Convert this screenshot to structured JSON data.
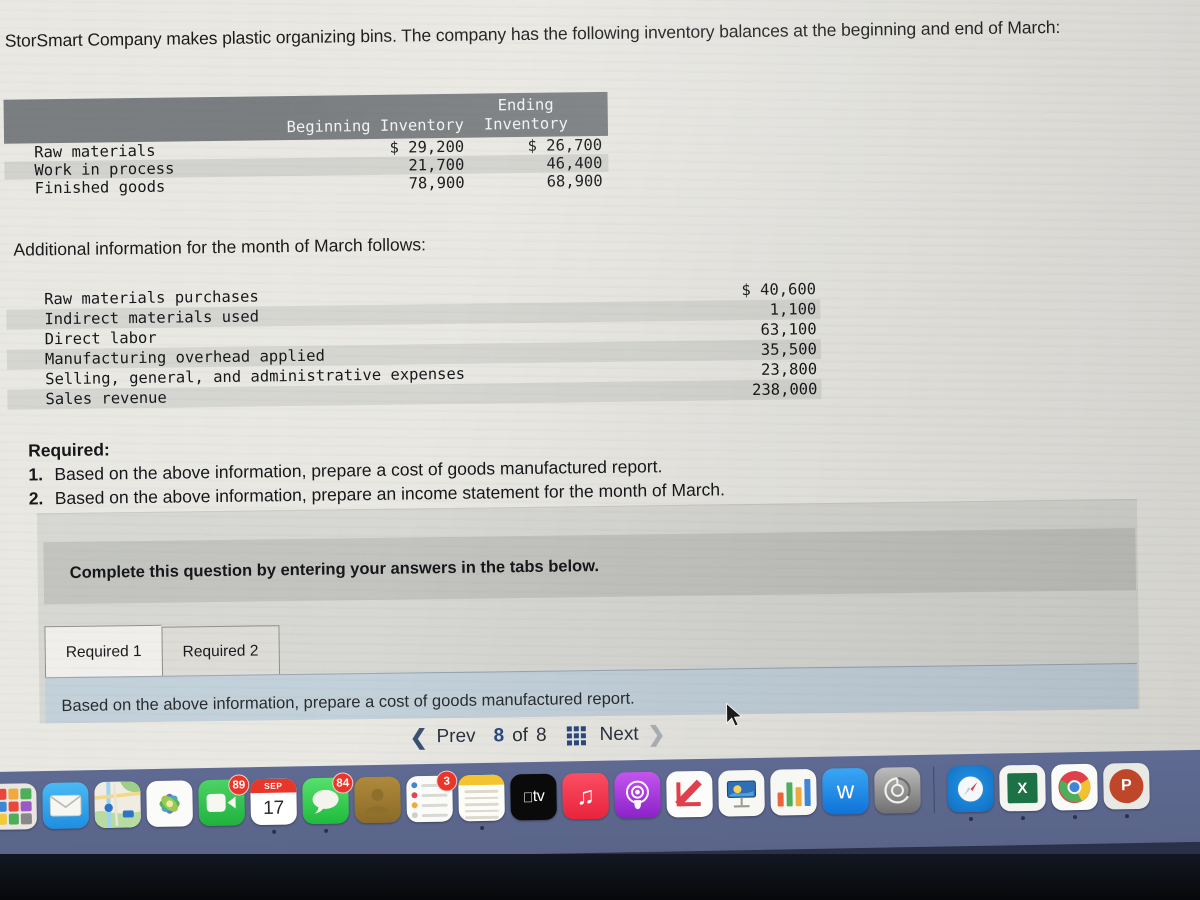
{
  "document": {
    "intro": "StorSmart Company makes plastic organizing bins. The company has the following inventory balances at the beginning and end of March:",
    "additional_title": "Additional information for the month of March follows:",
    "required_heading": "Required:",
    "required_items": [
      {
        "num": "1.",
        "text": "Based on the above information, prepare a cost of goods manufactured report."
      },
      {
        "num": "2.",
        "text": "Based on the above information, prepare an income statement for the month of March."
      }
    ]
  },
  "inventory_table": {
    "columns": [
      "",
      "Beginning Inventory",
      "Ending Inventory"
    ],
    "header_ending_line1": "Ending",
    "header_ending_line2": "Inventory",
    "header_beginning": "Beginning Inventory",
    "rows": [
      {
        "label": "Raw materials",
        "beginning": "$ 29,200",
        "ending": "$ 26,700"
      },
      {
        "label": "Work in process",
        "beginning": "21,700",
        "ending": "46,400"
      },
      {
        "label": "Finished goods",
        "beginning": "78,900",
        "ending": "68,900"
      }
    ]
  },
  "additional_info": {
    "rows": [
      {
        "label": "Raw materials purchases",
        "value": "$ 40,600"
      },
      {
        "label": "Indirect materials used",
        "value": "1,100"
      },
      {
        "label": "Direct labor",
        "value": "63,100"
      },
      {
        "label": "Manufacturing overhead applied",
        "value": "35,500"
      },
      {
        "label": "Selling, general, and administrative expenses",
        "value": "23,800"
      },
      {
        "label": "Sales revenue",
        "value": "238,000"
      }
    ]
  },
  "answer_panel": {
    "banner": "Complete this question by entering your answers in the tabs below.",
    "tabs": [
      {
        "label": "Required 1",
        "active": true
      },
      {
        "label": "Required 2",
        "active": false
      }
    ],
    "tab_body_text": "Based on the above information, prepare a cost of goods manufactured report."
  },
  "pager": {
    "prev_label": "Prev",
    "next_label": "Next",
    "current_page": "8",
    "of_label": "of",
    "total_pages": "8",
    "grid_icon": "grid-icon"
  },
  "dock": {
    "items": [
      {
        "name": "launchpad",
        "label": "Launchpad"
      },
      {
        "name": "mail",
        "label": "Mail"
      },
      {
        "name": "maps",
        "label": "Maps"
      },
      {
        "name": "photos",
        "label": "Photos"
      },
      {
        "name": "facetime",
        "label": "FaceTime",
        "badge": "89"
      },
      {
        "name": "calendar",
        "label": "Calendar",
        "month": "SEP",
        "day": "17",
        "running": true
      },
      {
        "name": "messages",
        "label": "Messages",
        "badge": "84",
        "running": true
      },
      {
        "name": "contacts",
        "label": "Contacts"
      },
      {
        "name": "reminders",
        "label": "Reminders",
        "badge": "3"
      },
      {
        "name": "notes",
        "label": "Notes",
        "running": true
      },
      {
        "name": "apple-tv",
        "label": "tv"
      },
      {
        "name": "music",
        "label": "Music"
      },
      {
        "name": "podcasts",
        "label": "Podcasts"
      },
      {
        "name": "news",
        "label": "News"
      },
      {
        "name": "keynote",
        "label": "Keynote"
      },
      {
        "name": "numbers",
        "label": "Numbers"
      },
      {
        "name": "app-store",
        "label": "App Store"
      },
      {
        "name": "system-settings",
        "label": "System Settings"
      },
      {
        "name": "safari",
        "label": "Safari",
        "running": true
      },
      {
        "name": "excel",
        "label": "X",
        "running": true
      },
      {
        "name": "chrome",
        "label": "Chrome",
        "running": true
      },
      {
        "name": "powerpoint",
        "label": "P",
        "running": true
      }
    ]
  },
  "colors": {
    "page_bg": "#e9e8e3",
    "table_header": "#7b7e81",
    "panel_bg": "#d7d7d3",
    "panel_banner": "#c3c4c0",
    "tab_body": "#c3d1db",
    "accent_blue": "#2b4a80",
    "badge_red": "#e8372a",
    "dock_bg": "#5e6a92"
  }
}
